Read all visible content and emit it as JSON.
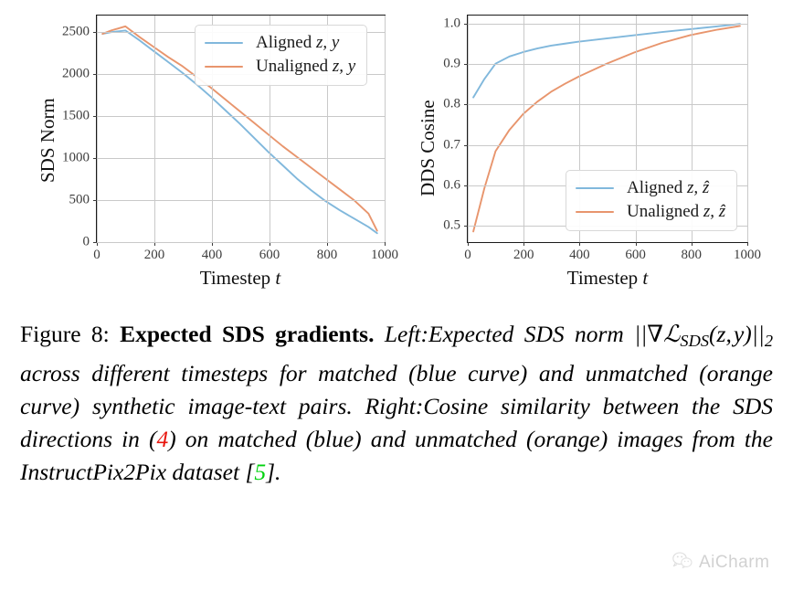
{
  "figure": {
    "caption_label": "Figure 8:",
    "caption_title": "Expected SDS gradients.",
    "caption_segments": {
      "left_lead": "Left:",
      "left_text_a": "Expected SDS norm ",
      "left_math": "||∇ℒSDS(z, y)||2",
      "left_text_b": " across different timesteps for matched (blue curve) and unmatched (orange curve) synthetic image-text pairs.",
      "right_lead": "Right:",
      "right_text_a": "Cosine similarity between the SDS directions in (",
      "right_ref_eq": "4",
      "right_text_b": ") on matched (blue) and unmatched (orange) images from the InstructPix2Pix dataset [",
      "right_ref_cite": "5",
      "right_text_c": "]."
    }
  },
  "watermark": {
    "icon": "wechat-icon",
    "text": "AiCharm"
  },
  "colors": {
    "blue": "#81b8dc",
    "orange": "#e8956d",
    "grid": "#c9c9c9",
    "axis": "#1a1a1a",
    "ref_red": "#e8140c",
    "ref_green": "#00d20d"
  },
  "chart_data": [
    {
      "id": "left",
      "type": "line",
      "title": "",
      "xlabel": "Timestep t",
      "ylabel": "SDS Norm",
      "xlim": [
        0,
        1000
      ],
      "ylim": [
        0,
        2700
      ],
      "xticks": [
        0,
        200,
        400,
        600,
        800,
        1000
      ],
      "xticklabels": [
        "0",
        "200",
        "400",
        "600",
        "800",
        "1000"
      ],
      "yticks": [
        0,
        500,
        1000,
        1500,
        2000,
        2500
      ],
      "yticklabels": [
        "0",
        "500",
        "1000",
        "1500",
        "2000",
        "2500"
      ],
      "grid": true,
      "legend_position": "upper right",
      "series": [
        {
          "name": "Aligned z, y",
          "name_plain": "Aligned",
          "math": "z, y",
          "color": "#81b8dc",
          "x": [
            20,
            50,
            100,
            150,
            200,
            250,
            300,
            350,
            400,
            450,
            500,
            550,
            600,
            650,
            700,
            750,
            800,
            850,
            900,
            950,
            980
          ],
          "y": [
            2480,
            2500,
            2520,
            2400,
            2270,
            2140,
            2010,
            1870,
            1720,
            1560,
            1400,
            1230,
            1060,
            900,
            740,
            600,
            470,
            360,
            260,
            160,
            85
          ]
        },
        {
          "name": "Unaligned z, y",
          "name_plain": "Unaligned",
          "math": "z, y",
          "color": "#e8956d",
          "x": [
            20,
            50,
            100,
            150,
            200,
            250,
            300,
            350,
            400,
            450,
            500,
            550,
            600,
            650,
            700,
            750,
            800,
            850,
            900,
            950,
            980
          ],
          "y": [
            2480,
            2520,
            2570,
            2440,
            2320,
            2200,
            2090,
            1960,
            1830,
            1690,
            1550,
            1410,
            1270,
            1130,
            1000,
            870,
            740,
            610,
            480,
            320,
            115
          ]
        }
      ]
    },
    {
      "id": "right",
      "type": "line",
      "title": "",
      "xlabel": "Timestep t",
      "ylabel": "DDS Cosine",
      "xlim": [
        0,
        1000
      ],
      "ylim": [
        0.46,
        1.02
      ],
      "xticks": [
        0,
        200,
        400,
        600,
        800,
        1000
      ],
      "xticklabels": [
        "0",
        "200",
        "400",
        "600",
        "800",
        "1000"
      ],
      "yticks": [
        0.5,
        0.6,
        0.7,
        0.8,
        0.9,
        1.0
      ],
      "yticklabels": [
        "0.5",
        "0.6",
        "0.7",
        "0.8",
        "0.9",
        "1.0"
      ],
      "grid": true,
      "legend_position": "lower right",
      "series": [
        {
          "name": "Aligned z, ẑ",
          "name_plain": "Aligned",
          "math": "z, ẑ",
          "color": "#81b8dc",
          "x": [
            20,
            60,
            100,
            150,
            200,
            250,
            300,
            350,
            400,
            500,
            600,
            700,
            800,
            900,
            980
          ],
          "y": [
            0.816,
            0.862,
            0.9,
            0.918,
            0.929,
            0.938,
            0.945,
            0.95,
            0.955,
            0.963,
            0.971,
            0.979,
            0.986,
            0.993,
            0.999
          ]
        },
        {
          "name": "Unaligned z, ẑ",
          "name_plain": "Unaligned",
          "math": "z, ẑ",
          "color": "#e8956d",
          "x": [
            20,
            60,
            100,
            150,
            200,
            250,
            300,
            350,
            400,
            500,
            600,
            700,
            800,
            900,
            980
          ],
          "y": [
            0.482,
            0.59,
            0.682,
            0.735,
            0.775,
            0.805,
            0.83,
            0.85,
            0.868,
            0.9,
            0.928,
            0.952,
            0.971,
            0.985,
            0.994
          ]
        }
      ]
    }
  ]
}
